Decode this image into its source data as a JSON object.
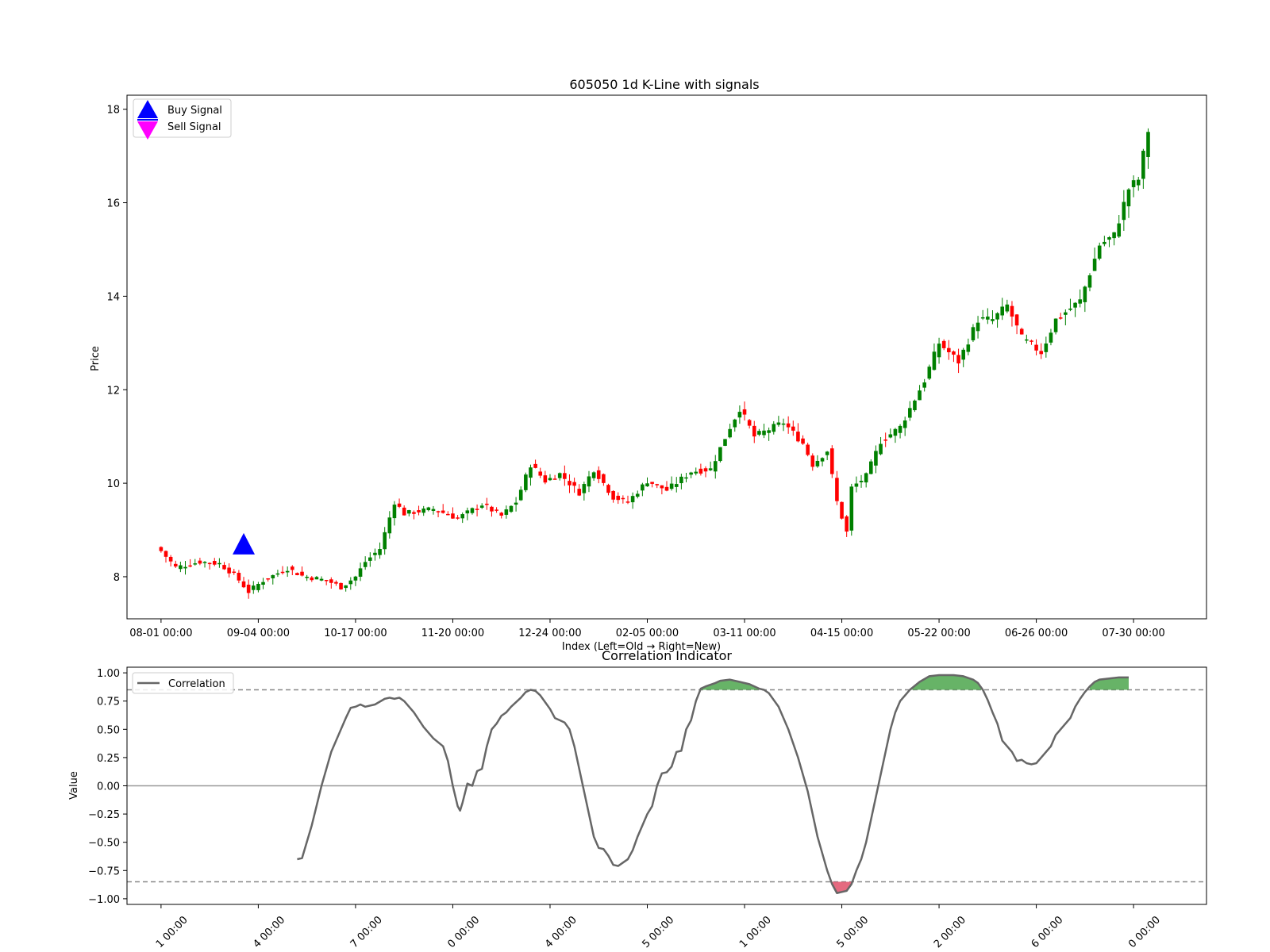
{
  "chart_data": [
    {
      "type": "candlestick",
      "title": "605050 1d K-Line with signals",
      "xlabel": "Index (Left=Old → Right=New)",
      "ylabel": "Price",
      "ylim": [
        7.1,
        18.3
      ],
      "xlim": [
        -7,
        215
      ],
      "yticks": [
        8,
        10,
        12,
        14,
        16,
        18
      ],
      "xticks": [
        {
          "index": 0,
          "label": "08-01 00:00"
        },
        {
          "index": 20,
          "label": "09-04 00:00"
        },
        {
          "index": 40,
          "label": "10-17 00:00"
        },
        {
          "index": 60,
          "label": "11-20 00:00"
        },
        {
          "index": 80,
          "label": "12-24 00:00"
        },
        {
          "index": 100,
          "label": "02-05 00:00"
        },
        {
          "index": 120,
          "label": "03-11 00:00"
        },
        {
          "index": 140,
          "label": "04-15 00:00"
        },
        {
          "index": 160,
          "label": "05-22 00:00"
        },
        {
          "index": 180,
          "label": "06-26 00:00"
        },
        {
          "index": 200,
          "label": "07-30 00:00"
        }
      ],
      "up_color": "#008000",
      "down_color": "#ff0000",
      "close_path": [
        [
          0,
          8.55
        ],
        [
          3,
          8.2
        ],
        [
          8,
          8.32
        ],
        [
          12,
          8.28
        ],
        [
          15,
          8.05
        ],
        [
          18,
          7.68
        ],
        [
          21,
          7.92
        ],
        [
          26,
          8.18
        ],
        [
          29,
          8.02
        ],
        [
          34,
          7.92
        ],
        [
          37,
          7.78
        ],
        [
          40,
          8.0
        ],
        [
          42,
          8.32
        ],
        [
          45,
          8.6
        ],
        [
          48,
          9.6
        ],
        [
          50,
          9.35
        ],
        [
          56,
          9.45
        ],
        [
          61,
          9.25
        ],
        [
          66,
          9.55
        ],
        [
          70,
          9.3
        ],
        [
          73,
          9.6
        ],
        [
          76,
          10.4
        ],
        [
          79,
          10.05
        ],
        [
          82,
          10.2
        ],
        [
          86,
          9.8
        ],
        [
          89,
          10.3
        ],
        [
          93,
          9.7
        ],
        [
          96,
          9.6
        ],
        [
          100,
          10.05
        ],
        [
          104,
          9.85
        ],
        [
          109,
          10.25
        ],
        [
          113,
          10.3
        ],
        [
          117,
          11.2
        ],
        [
          119,
          11.6
        ],
        [
          122,
          11.0
        ],
        [
          128,
          11.3
        ],
        [
          132,
          10.85
        ],
        [
          134,
          10.4
        ],
        [
          137,
          10.7
        ],
        [
          139,
          9.6
        ],
        [
          141,
          8.95
        ],
        [
          142,
          9.9
        ],
        [
          145,
          10.15
        ],
        [
          148,
          10.9
        ],
        [
          152,
          11.2
        ],
        [
          157,
          12.2
        ],
        [
          160,
          13.0
        ],
        [
          164,
          12.6
        ],
        [
          168,
          13.5
        ],
        [
          171,
          13.5
        ],
        [
          174,
          13.8
        ],
        [
          177,
          13.1
        ],
        [
          181,
          12.8
        ],
        [
          184,
          13.5
        ],
        [
          189,
          13.9
        ],
        [
          193,
          15.1
        ],
        [
          196,
          15.3
        ],
        [
          199,
          16.3
        ],
        [
          201,
          16.5
        ],
        [
          203,
          17.55
        ]
      ],
      "signals": [
        {
          "name": "Buy Signal",
          "index": 17,
          "price": 8.68,
          "marker": "triangle-up",
          "color": "#0000ff"
        },
        {
          "name": "Sell Signal",
          "marker": "triangle-down",
          "color": "#ff00ff"
        }
      ],
      "legend": {
        "placement": "top-left",
        "entries": [
          "Buy Signal",
          "Sell Signal"
        ]
      },
      "grid": false
    },
    {
      "type": "line",
      "title": "Correlation Indicator",
      "ylabel": "Value",
      "ylim": [
        -1.05,
        1.05
      ],
      "yticks": [
        1.0,
        0.75,
        0.5,
        0.25,
        0.0,
        -0.25,
        -0.5,
        -0.75,
        -1.0
      ],
      "ytick_labels": [
        "1.00",
        "0.75",
        "0.50",
        "0.25",
        "0.00",
        "−0.25",
        "−0.50",
        "−0.75",
        "−1.00"
      ],
      "xtick_labels": [
        "1 00:00",
        "4 00:00",
        "7 00:00",
        "0 00:00",
        "4 00:00",
        "5 00:00",
        "1 00:00",
        "5 00:00",
        "2 00:00",
        "6 00:00",
        "0 00:00"
      ],
      "thresholds": [
        0.85,
        -0.85
      ],
      "fill_above_color": "#4ca64c",
      "fill_below_color": "#e0506a",
      "series": [
        {
          "name": "Correlation",
          "color": "#666666",
          "points": [
            [
              28,
              -0.65
            ],
            [
              29,
              -0.64
            ],
            [
              31,
              -0.35
            ],
            [
              33,
              0.0
            ],
            [
              35,
              0.3
            ],
            [
              37,
              0.5
            ],
            [
              38,
              0.6
            ],
            [
              39,
              0.69
            ],
            [
              40,
              0.7
            ],
            [
              41,
              0.72
            ],
            [
              42,
              0.7
            ],
            [
              44,
              0.72
            ],
            [
              46,
              0.77
            ],
            [
              47,
              0.78
            ],
            [
              48,
              0.77
            ],
            [
              49,
              0.78
            ],
            [
              50,
              0.75
            ],
            [
              52,
              0.65
            ],
            [
              54,
              0.52
            ],
            [
              56,
              0.42
            ],
            [
              58,
              0.35
            ],
            [
              59,
              0.22
            ],
            [
              60,
              0.0
            ],
            [
              61,
              -0.18
            ],
            [
              61.5,
              -0.22
            ],
            [
              62,
              -0.15
            ],
            [
              63,
              0.02
            ],
            [
              64,
              0.0
            ],
            [
              65,
              0.13
            ],
            [
              66,
              0.15
            ],
            [
              67,
              0.35
            ],
            [
              68,
              0.5
            ],
            [
              69,
              0.55
            ],
            [
              70,
              0.62
            ],
            [
              71,
              0.65
            ],
            [
              72,
              0.7
            ],
            [
              74,
              0.78
            ],
            [
              75,
              0.83
            ],
            [
              76,
              0.85
            ],
            [
              77,
              0.84
            ],
            [
              78,
              0.8
            ],
            [
              79,
              0.74
            ],
            [
              80,
              0.68
            ],
            [
              81,
              0.6
            ],
            [
              82,
              0.58
            ],
            [
              83,
              0.56
            ],
            [
              84,
              0.5
            ],
            [
              85,
              0.35
            ],
            [
              86,
              0.15
            ],
            [
              87,
              -0.05
            ],
            [
              88,
              -0.25
            ],
            [
              89,
              -0.45
            ],
            [
              90,
              -0.55
            ],
            [
              91,
              -0.56
            ],
            [
              92,
              -0.62
            ],
            [
              93,
              -0.7
            ],
            [
              94,
              -0.71
            ],
            [
              95,
              -0.68
            ],
            [
              96,
              -0.65
            ],
            [
              97,
              -0.57
            ],
            [
              98,
              -0.45
            ],
            [
              99,
              -0.35
            ],
            [
              100,
              -0.25
            ],
            [
              101,
              -0.18
            ],
            [
              102,
              0.0
            ],
            [
              103,
              0.11
            ],
            [
              104,
              0.12
            ],
            [
              105,
              0.17
            ],
            [
              106,
              0.3
            ],
            [
              107,
              0.31
            ],
            [
              108,
              0.5
            ],
            [
              109,
              0.58
            ],
            [
              110,
              0.75
            ],
            [
              111,
              0.86
            ],
            [
              112,
              0.88
            ],
            [
              114,
              0.91
            ],
            [
              115,
              0.93
            ],
            [
              117,
              0.94
            ],
            [
              119,
              0.92
            ],
            [
              121,
              0.9
            ],
            [
              123,
              0.86
            ],
            [
              124,
              0.85
            ],
            [
              125,
              0.82
            ],
            [
              127,
              0.7
            ],
            [
              129,
              0.5
            ],
            [
              131,
              0.25
            ],
            [
              133,
              -0.05
            ],
            [
              134,
              -0.25
            ],
            [
              135,
              -0.45
            ],
            [
              136,
              -0.6
            ],
            [
              137,
              -0.75
            ],
            [
              138,
              -0.87
            ],
            [
              139,
              -0.95
            ],
            [
              140,
              -0.94
            ],
            [
              141,
              -0.93
            ],
            [
              142,
              -0.87
            ],
            [
              143,
              -0.75
            ],
            [
              144,
              -0.65
            ],
            [
              145,
              -0.5
            ],
            [
              146,
              -0.3
            ],
            [
              147,
              -0.1
            ],
            [
              148,
              0.1
            ],
            [
              149,
              0.3
            ],
            [
              150,
              0.5
            ],
            [
              151,
              0.65
            ],
            [
              152,
              0.75
            ],
            [
              154,
              0.85
            ],
            [
              156,
              0.92
            ],
            [
              158,
              0.97
            ],
            [
              160,
              0.98
            ],
            [
              163,
              0.98
            ],
            [
              165,
              0.97
            ],
            [
              167,
              0.94
            ],
            [
              168,
              0.91
            ],
            [
              169,
              0.85
            ],
            [
              170,
              0.76
            ],
            [
              171,
              0.65
            ],
            [
              172,
              0.55
            ],
            [
              173,
              0.4
            ],
            [
              174,
              0.35
            ],
            [
              175,
              0.3
            ],
            [
              176,
              0.22
            ],
            [
              177,
              0.23
            ],
            [
              178,
              0.2
            ],
            [
              179,
              0.19
            ],
            [
              180,
              0.2
            ],
            [
              181,
              0.25
            ],
            [
              182,
              0.3
            ],
            [
              183,
              0.35
            ],
            [
              184,
              0.45
            ],
            [
              185,
              0.5
            ],
            [
              186,
              0.55
            ],
            [
              187,
              0.6
            ],
            [
              188,
              0.7
            ],
            [
              189,
              0.77
            ],
            [
              190,
              0.83
            ],
            [
              191,
              0.88
            ],
            [
              192,
              0.92
            ],
            [
              193,
              0.94
            ],
            [
              195,
              0.95
            ],
            [
              197,
              0.96
            ],
            [
              199,
              0.96
            ]
          ]
        }
      ],
      "legend": {
        "placement": "top-left",
        "entries": [
          "Correlation"
        ]
      },
      "grid": false
    }
  ]
}
